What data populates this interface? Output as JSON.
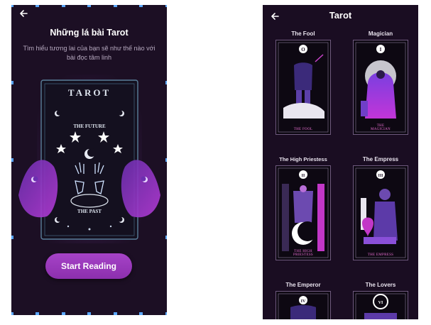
{
  "left_screen": {
    "title": "Những lá bài Tarot",
    "subtitle": "Tìm hiểu tương lai của bạn sẽ như thế nào với bài đọc tâm linh",
    "card": {
      "heading": "TAROT",
      "top_text": "THE FUTURE",
      "bottom_text": "THE PAST"
    },
    "cta_label": "Start Reading"
  },
  "right_screen": {
    "title": "Tarot",
    "cards": [
      {
        "name": "The Fool",
        "numeral": "O",
        "caption": "THE FOOL"
      },
      {
        "name": "Magician",
        "numeral": "I",
        "caption": "THE MAGICIAN"
      },
      {
        "name": "The High Priestess",
        "numeral": "II",
        "caption": "THE HIGH PRIESTESS"
      },
      {
        "name": "The Empress",
        "numeral": "III",
        "caption": "THE EMPRESS"
      },
      {
        "name": "The Emperor",
        "numeral": "IV",
        "caption": ""
      },
      {
        "name": "The Lovers",
        "numeral": "VI",
        "caption": ""
      }
    ]
  },
  "colors": {
    "background": "#1c0f24",
    "accent": "#9b3dbd",
    "card_border": "#6f5a7e",
    "caption_pink": "#ea6fd3"
  }
}
